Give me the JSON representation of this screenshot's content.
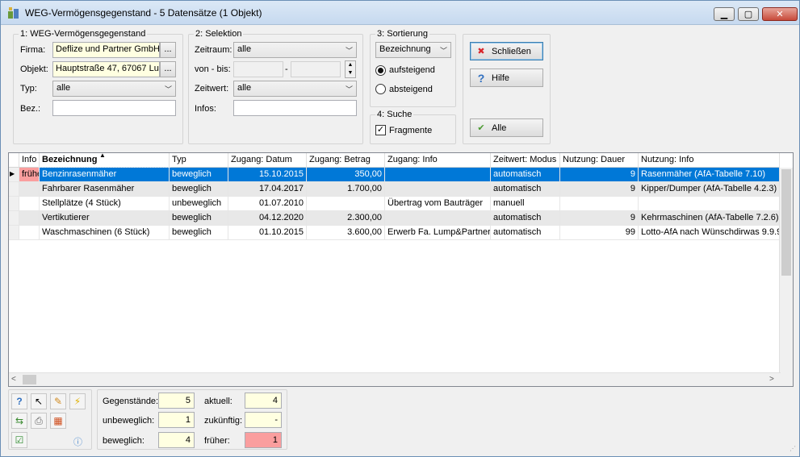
{
  "window": {
    "title": "WEG-Vermögensgegenstand - 5 Datensätze (1 Objekt)"
  },
  "group1": {
    "title": "1: WEG-Vermögensgegenstand",
    "firma_label": "Firma:",
    "firma_value": "Deflize und Partner GmbH",
    "objekt_label": "Objekt:",
    "objekt_value": "Hauptstraße 47, 67067 Lud",
    "typ_label": "Typ:",
    "typ_value": "alle",
    "bez_label": "Bez.:",
    "bez_value": "",
    "dots": "..."
  },
  "group2": {
    "title": "2: Selektion",
    "zeitraum_label": "Zeitraum:",
    "zeitraum_value": "alle",
    "vonbis_label": "von - bis:",
    "dash": "-",
    "zeitwert_label": "Zeitwert:",
    "zeitwert_value": "alle",
    "infos_label": "Infos:",
    "infos_value": ""
  },
  "group3": {
    "title": "3: Sortierung",
    "sort_value": "Bezeichnung",
    "asc_label": "aufsteigend",
    "desc_label": "absteigend"
  },
  "group4": {
    "title": "4: Suche",
    "fragmente_label": "Fragmente"
  },
  "buttons": {
    "close": "Schließen",
    "help": "Hilfe",
    "all": "Alle"
  },
  "grid": {
    "columns": [
      "Info",
      "Bezeichnung",
      "Typ",
      "Zugang: Datum",
      "Zugang: Betrag",
      "Zugang: Info",
      "Zeitwert: Modus",
      "Nutzung: Dauer",
      "Nutzung: Info"
    ],
    "rows": [
      {
        "info": "frühe",
        "bez": "Benzinrasenmäher",
        "typ": "beweglich",
        "datum": "15.10.2015",
        "betrag": "350,00",
        "zinfo": "",
        "modus": "automatisch",
        "dauer": "9",
        "ninfo": "Rasenmäher (AfA-Tabelle 7.10)"
      },
      {
        "info": "",
        "bez": "Fahrbarer Rasenmäher",
        "typ": "beweglich",
        "datum": "17.04.2017",
        "betrag": "1.700,00",
        "zinfo": "",
        "modus": "automatisch",
        "dauer": "9",
        "ninfo": "Kipper/Dumper (AfA-Tabelle 4.2.3)"
      },
      {
        "info": "",
        "bez": "Stellplätze (4 Stück)",
        "typ": "unbeweglich",
        "datum": "01.07.2010",
        "betrag": "",
        "zinfo": "Übertrag vom Bauträger",
        "modus": "manuell",
        "dauer": "",
        "ninfo": ""
      },
      {
        "info": "",
        "bez": "Vertikutierer",
        "typ": "beweglich",
        "datum": "04.12.2020",
        "betrag": "2.300,00",
        "zinfo": "",
        "modus": "automatisch",
        "dauer": "9",
        "ninfo": "Kehrmaschinen (AfA-Tabelle 7.2.6)"
      },
      {
        "info": "",
        "bez": "Waschmaschinen (6 Stück)",
        "typ": "beweglich",
        "datum": "01.10.2015",
        "betrag": "3.600,00",
        "zinfo": "Erwerb Fa. Lump&Partner",
        "modus": "automatisch",
        "dauer": "99",
        "ninfo": "Lotto-AfA nach Wünschdirwas 9.9.9"
      }
    ]
  },
  "stats": {
    "gegenstaende_label": "Gegenstände:",
    "gegenstaende": "5",
    "unbeweglich_label": "unbeweglich:",
    "unbeweglich": "1",
    "beweglich_label": "beweglich:",
    "beweglich": "4",
    "aktuell_label": "aktuell:",
    "aktuell": "4",
    "zukuenftig_label": "zukünftig:",
    "zukuenftig": "-",
    "frueher_label": "früher:",
    "frueher": "1"
  },
  "colors": {
    "selected_row": "#0078d7",
    "alt_row": "#e8e8e8",
    "info_highlight": "#fa9e9e",
    "yellow_field": "#ffffe1"
  }
}
